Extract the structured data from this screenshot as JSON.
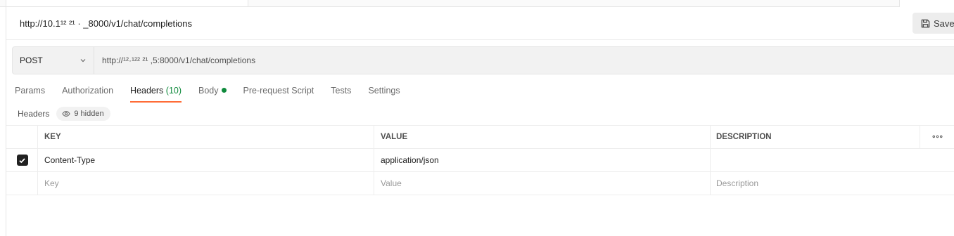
{
  "request": {
    "name": "http://10.1¹² ²¹ · _8000/v1/chat/completions",
    "method": "POST",
    "url": "http://¹²·¹²² ²¹ ,5:8000/v1/chat/completions"
  },
  "toolbar": {
    "save_label": "Save",
    "save_icon": "save-icon"
  },
  "tabs": [
    {
      "label": "Params"
    },
    {
      "label": "Authorization"
    },
    {
      "label": "Headers",
      "count": "(10)",
      "active": true
    },
    {
      "label": "Body",
      "has_dot": true
    },
    {
      "label": "Pre-request Script"
    },
    {
      "label": "Tests"
    },
    {
      "label": "Settings"
    }
  ],
  "headers_panel": {
    "title": "Headers",
    "hidden_label": "9 hidden"
  },
  "table": {
    "columns": [
      "KEY",
      "VALUE",
      "DESCRIPTION"
    ],
    "more_label": "∘∘∘",
    "rows": [
      {
        "checked": true,
        "key": "Content-Type",
        "value": "application/json",
        "description": ""
      }
    ],
    "placeholders": {
      "key": "Key",
      "value": "Value",
      "description": "Description"
    }
  },
  "colors": {
    "accent": "#ff6c37",
    "status_green": "#0f8a3c"
  }
}
